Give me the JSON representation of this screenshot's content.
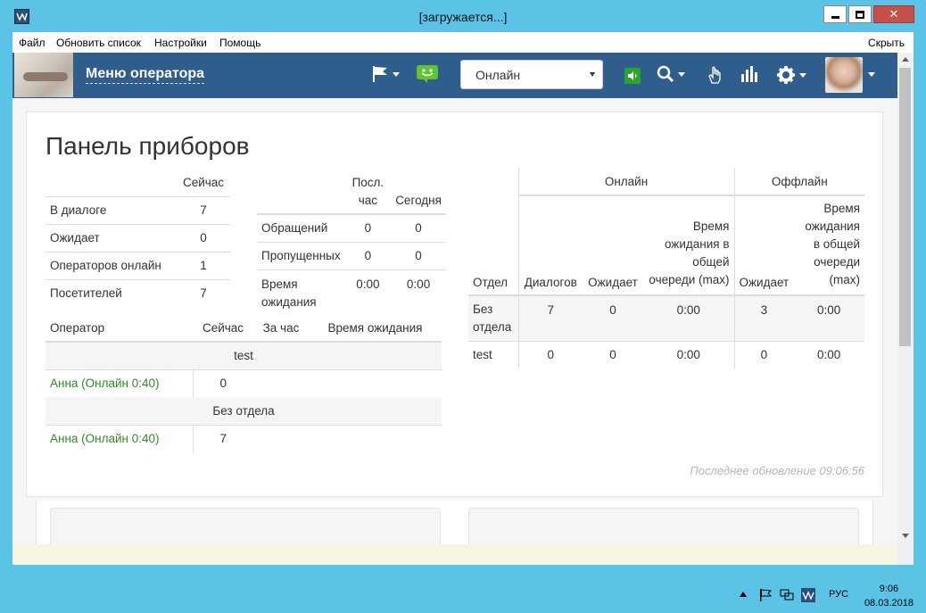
{
  "window": {
    "title": "[загружается...]",
    "close_glyph": "✕"
  },
  "menubar": {
    "items": [
      "Файл",
      "Обновить список",
      "Настройки",
      "Помощь"
    ],
    "hide_label": "Скрыть"
  },
  "navbar": {
    "title": "Меню оператора",
    "status_select": {
      "value": "Онлайн"
    },
    "icons": [
      "flag-icon",
      "chat-icon",
      "sound-icon",
      "search-icon",
      "hand-icon",
      "stats-icon",
      "gear-icon",
      "avatar"
    ]
  },
  "dashboard": {
    "title": "Панель приборов",
    "now_table": {
      "header": "Сейчас",
      "rows": [
        {
          "label": "В диалоге",
          "value": "7"
        },
        {
          "label": "Ожидает",
          "value": "0"
        },
        {
          "label": "Операторов онлайн",
          "value": "1"
        },
        {
          "label": "Посетителей",
          "value": "7"
        }
      ]
    },
    "hour_table": {
      "col1_line1": "Посл.",
      "col1_line2": "час",
      "col2": "Сегодня",
      "rows": [
        {
          "label": "Обращений",
          "hour": "0",
          "today": "0"
        },
        {
          "label": "Пропущенных",
          "hour": "0",
          "today": "0"
        },
        {
          "label": "Время ожидания",
          "hour": "0:00",
          "today": "0:00"
        }
      ]
    },
    "operators_table": {
      "headers": [
        "Оператор",
        "Сейчас",
        "За час",
        "Время ожидания"
      ],
      "groups": [
        {
          "name": "test",
          "operator": "Анна (Онлайн 0:40)",
          "now": "0"
        },
        {
          "name": "Без отдела",
          "operator": "Анна (Онлайн 0:40)",
          "now": "7"
        }
      ]
    },
    "dept_table": {
      "group_online": "Онлайн",
      "group_offline": "Оффлайн",
      "headers": [
        "Отдел",
        "Диалогов",
        "Ожидает",
        "Время ожидания в общей очереди (max)",
        "Ожидает",
        "Время ожидания в общей очереди (max)"
      ],
      "rows": [
        {
          "dept": "Без отдела",
          "dialogs": "7",
          "waiting": "0",
          "wait_time": "0:00",
          "off_waiting": "3",
          "off_wait_time": "0:00"
        },
        {
          "dept": "test",
          "dialogs": "0",
          "waiting": "0",
          "wait_time": "0:00",
          "off_waiting": "0",
          "off_wait_time": "0:00"
        }
      ]
    },
    "last_update": "Последнее обновление 09:06:56"
  },
  "taskbar": {
    "lang": "РУС",
    "time": "9:06",
    "date": "08.03.2018"
  },
  "colors": {
    "navbar": "#2f5d8c",
    "desktop": "#5bc3e6",
    "online_green": "#2e8b26",
    "close_red": "#c7504a"
  }
}
